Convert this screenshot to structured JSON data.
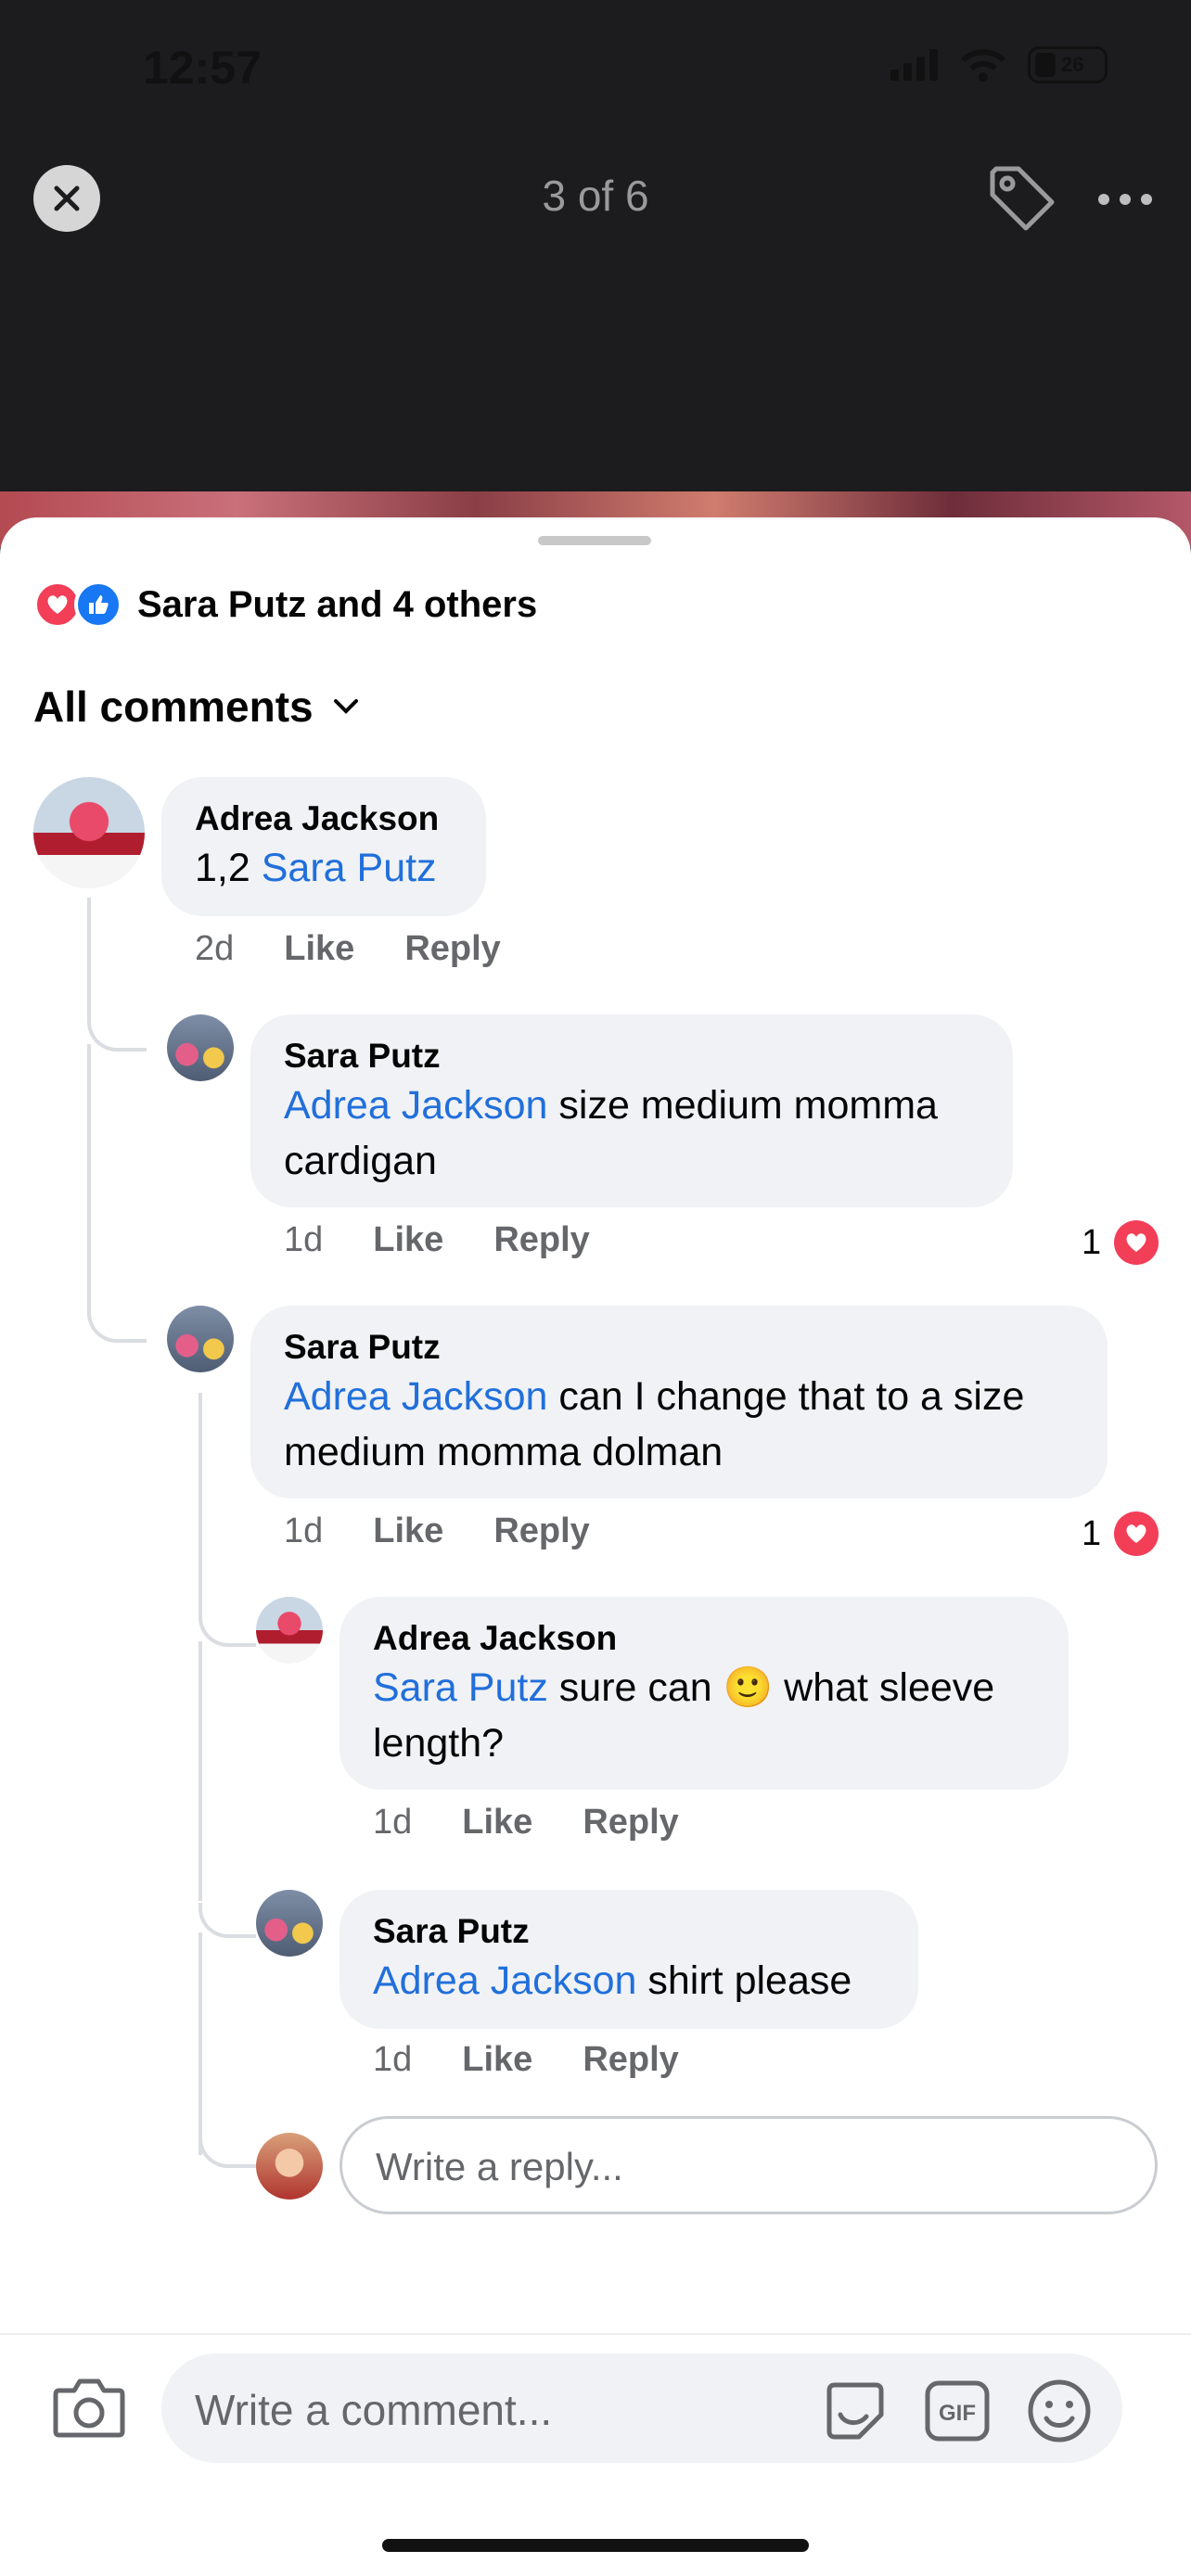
{
  "status_bar": {
    "time": "12:57",
    "battery": "26"
  },
  "viewer": {
    "counter": "3 of 6"
  },
  "reactions": {
    "summary": "Sara Putz and 4 others"
  },
  "filter": {
    "label": "All comments"
  },
  "comments": [
    {
      "author": "Adrea Jackson",
      "prefix": "1,2 ",
      "mention": "Sara Putz",
      "text": "",
      "time": "2d",
      "like": "Like",
      "reply": "Reply"
    },
    {
      "author": "Sara Putz",
      "mention": "Adrea Jackson",
      "text": " size medium momma cardigan",
      "time": "1d",
      "like": "Like",
      "reply": "Reply",
      "reaction_count": "1"
    },
    {
      "author": "Sara Putz",
      "mention": "Adrea Jackson",
      "text": " can I change that to a size medium momma dolman",
      "time": "1d",
      "like": "Like",
      "reply": "Reply",
      "reaction_count": "1"
    },
    {
      "author": "Adrea Jackson",
      "mention": "Sara Putz",
      "text_a": " sure can ",
      "emoji": "🙂",
      "text_b": " what sleeve length?",
      "time": "1d",
      "like": "Like",
      "reply": "Reply"
    },
    {
      "author": "Sara Putz",
      "mention": "Adrea Jackson",
      "text": " shirt please",
      "time": "1d",
      "like": "Like",
      "reply": "Reply"
    }
  ],
  "reply_box": {
    "placeholder": "Write a reply..."
  },
  "composer": {
    "placeholder": "Write a comment..."
  },
  "icons": {
    "close": "close-icon",
    "tag": "tag-icon",
    "more": "more-icon",
    "love": "love-reaction-icon",
    "like": "like-reaction-icon",
    "chevron": "chevron-down-icon",
    "camera": "camera-icon",
    "sticker": "sticker-icon",
    "gif": "gif-icon",
    "emoji": "emoji-icon",
    "heart": "heart-icon"
  },
  "colors": {
    "accent": "#216fdb",
    "love": "#f33e58",
    "like": "#1877f2",
    "bubble": "#f0f2f5"
  }
}
